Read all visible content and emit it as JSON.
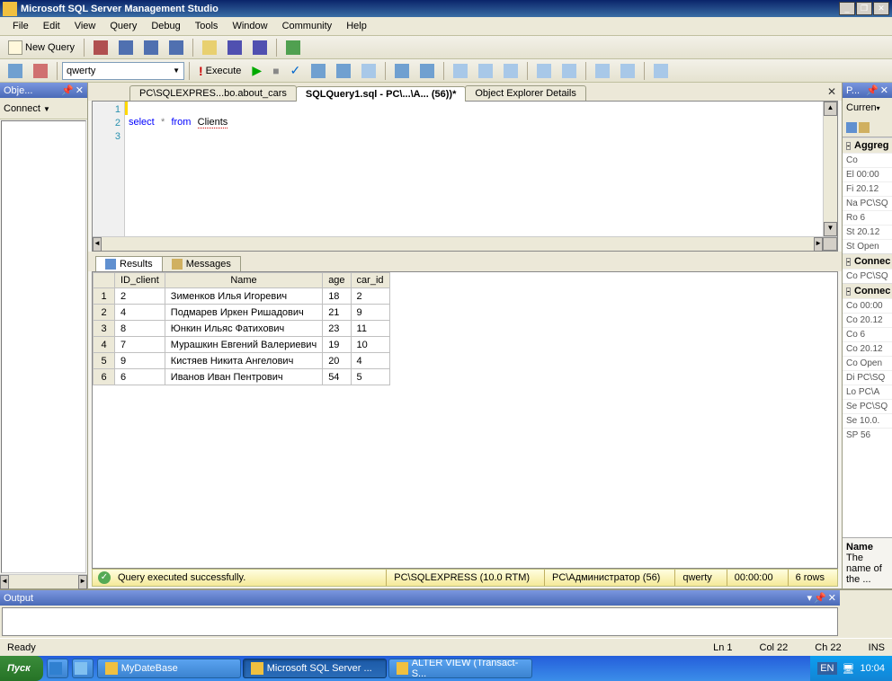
{
  "window": {
    "title": "Microsoft SQL Server Management Studio"
  },
  "menu": [
    "File",
    "Edit",
    "View",
    "Query",
    "Debug",
    "Tools",
    "Window",
    "Community",
    "Help"
  ],
  "toolbar1": {
    "newQuery": "New Query"
  },
  "toolbar2": {
    "db": "qwerty",
    "execute": "Execute"
  },
  "leftPanel": {
    "title": "Obje...",
    "connect": "Connect"
  },
  "tabs": [
    {
      "label": "PC\\SQLEXPRES...bo.about_cars",
      "active": false
    },
    {
      "label": "SQLQuery1.sql - PC\\...\\А... (56))*",
      "active": true
    },
    {
      "label": "Object Explorer Details",
      "active": false
    }
  ],
  "editor": {
    "lines": [
      "1",
      "2",
      "3"
    ],
    "sql": {
      "kw1": "select",
      "op": "*",
      "kw2": "from",
      "ident": "Clients"
    }
  },
  "resultTabs": {
    "results": "Results",
    "messages": "Messages"
  },
  "grid": {
    "headers": [
      "",
      "ID_client",
      "Name",
      "age",
      "car_id"
    ],
    "rows": [
      [
        "1",
        "2",
        "Зименков Илья Игоревич",
        "18",
        "2"
      ],
      [
        "2",
        "4",
        "Подмарев Иркен Ришадович",
        "21",
        "9"
      ],
      [
        "3",
        "8",
        "Юнкин Ильяс Фатихович",
        "23",
        "11"
      ],
      [
        "4",
        "7",
        "Мурашкин Евгений Валериевич",
        "19",
        "10"
      ],
      [
        "5",
        "9",
        "Кистяев Никита Ангелович",
        "20",
        "4"
      ],
      [
        "6",
        "6",
        "Иванов Иван Пентрович",
        "54",
        "5"
      ]
    ]
  },
  "qstatus": {
    "msg": "Query executed successfully.",
    "server": "PC\\SQLEXPRESS (10.0 RTM)",
    "user": "PC\\Администратор (56)",
    "db": "qwerty",
    "time": "00:00:00",
    "rows": "6 rows"
  },
  "outputPanel": {
    "title": "Output"
  },
  "props": {
    "title": "P...",
    "current": "Curren",
    "groups": {
      "agg": "Aggreg",
      "con1": "Connec",
      "con2": "Connec"
    },
    "rows1": [
      {
        "n": "Co",
        "v": ""
      },
      {
        "n": "El",
        "v": "00:00"
      },
      {
        "n": "Fi",
        "v": "20.12"
      },
      {
        "n": "Na",
        "v": "PC\\SQ"
      },
      {
        "n": "Ro",
        "v": "6"
      },
      {
        "n": "St",
        "v": "20.12"
      },
      {
        "n": "St",
        "v": "Open"
      }
    ],
    "rows2": [
      {
        "n": "Co",
        "v": "PC\\SQ"
      }
    ],
    "rows3": [
      {
        "n": "Co",
        "v": "00:00"
      },
      {
        "n": "Co",
        "v": "20.12"
      },
      {
        "n": "Co",
        "v": "6"
      },
      {
        "n": "Co",
        "v": "20.12"
      },
      {
        "n": "Co",
        "v": "Open"
      },
      {
        "n": "Di",
        "v": "PC\\SQ"
      },
      {
        "n": "Lo",
        "v": "PC\\А"
      },
      {
        "n": "Se",
        "v": "PC\\SQ"
      },
      {
        "n": "Se",
        "v": "10.0."
      },
      {
        "n": "SP",
        "v": "56"
      }
    ],
    "desc": {
      "label": "Name",
      "text": "The name of the ..."
    }
  },
  "statusbar": {
    "ready": "Ready",
    "ln": "Ln 1",
    "col": "Col 22",
    "ch": "Ch 22",
    "ins": "INS"
  },
  "taskbar": {
    "start": "Пуск",
    "items": [
      {
        "label": "MyDateBase",
        "active": false
      },
      {
        "label": "Microsoft SQL Server ...",
        "active": true
      },
      {
        "label": "ALTER VIEW (Transact-S...",
        "active": false
      }
    ],
    "lang": "EN",
    "clock": "10:04"
  }
}
